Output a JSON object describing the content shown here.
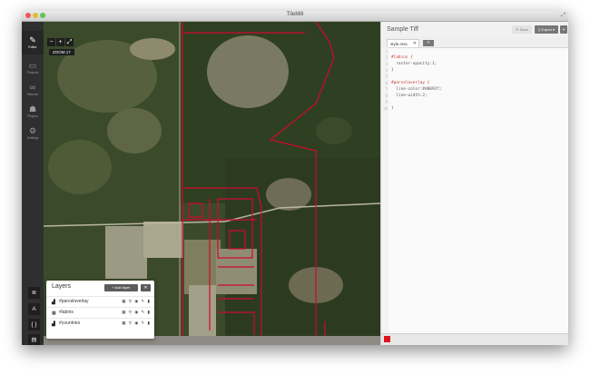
{
  "window": {
    "title": "TileMill"
  },
  "sidebar": {
    "items": [
      {
        "label": "Editor",
        "icon": "pencil-icon"
      },
      {
        "label": "Projects",
        "icon": "folder-icon"
      },
      {
        "label": "Manual",
        "icon": "book-icon"
      },
      {
        "label": "Plugins",
        "icon": "plugin-icon"
      },
      {
        "label": "Settings",
        "icon": "gear-icon"
      }
    ],
    "tools": [
      {
        "icon": "layers-icon",
        "glyph": "≣"
      },
      {
        "icon": "font-icon",
        "glyph": "A"
      },
      {
        "icon": "braces-icon",
        "glyph": "{ }"
      },
      {
        "icon": "stack-icon",
        "glyph": "▤"
      }
    ]
  },
  "map": {
    "zoom_buttons": [
      "−",
      "+",
      "⤢"
    ],
    "zoom_label": "ZOOM 17"
  },
  "layers": {
    "title": "Layers",
    "add_label": "+ Add layer",
    "close_label": "✕",
    "rows": [
      {
        "name": "#parceloverlay",
        "icon": "polygon-icon",
        "glyph": "▟"
      },
      {
        "name": "#labins",
        "icon": "raster-icon",
        "glyph": "▦"
      },
      {
        "name": "#countries",
        "icon": "polygon-icon",
        "glyph": "▟"
      }
    ],
    "row_actions": "▦ ⚲ ◉ ✎ ▮"
  },
  "editor": {
    "title": "Sample Tiff",
    "save_label": "Save",
    "export_label": "Export",
    "tab_label": "style.mss",
    "tab_close": "✕",
    "tab_add": "+",
    "line_numbers": [
      "1",
      "2",
      "3",
      "4",
      "5",
      "6",
      "7",
      "8",
      "9",
      "10"
    ],
    "code_lines": [
      "",
      "#labins {",
      "  raster-opacity:1;",
      "}",
      "",
      "#parceloverlay {",
      "  line-color:#d0092f;",
      "  line-width:2;",
      "",
      "}"
    ]
  },
  "colors": {
    "parcel_line": "#d0092f",
    "status_swatch": "#e0121e"
  }
}
